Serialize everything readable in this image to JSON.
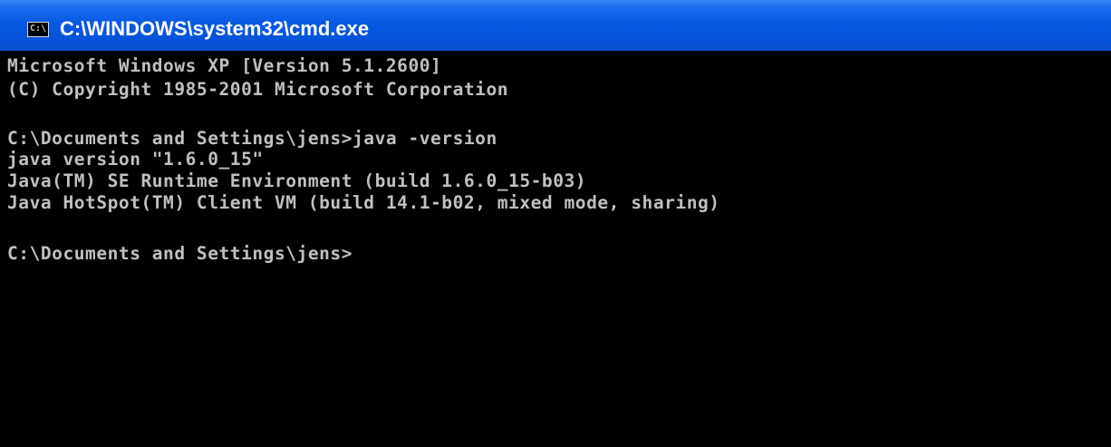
{
  "window": {
    "title": "C:\\WINDOWS\\system32\\cmd.exe",
    "icon": "cmd-console-icon",
    "icon_glyph": "C:\\"
  },
  "console": {
    "lines": [
      "Microsoft Windows XP [Version 5.1.2600]",
      "(C) Copyright 1985-2001 Microsoft Corporation",
      "",
      "C:\\Documents and Settings\\jens>java -version",
      "java version \"1.6.0_15\"",
      "Java(TM) SE Runtime Environment (build 1.6.0_15-b03)",
      "Java HotSpot(TM) Client VM (build 14.1-b02, mixed mode, sharing)",
      "",
      "C:\\Documents and Settings\\jens>"
    ]
  },
  "colors": {
    "titlebar": "#0858e3",
    "console_bg": "#000000",
    "console_text": "#c0c0c0"
  }
}
